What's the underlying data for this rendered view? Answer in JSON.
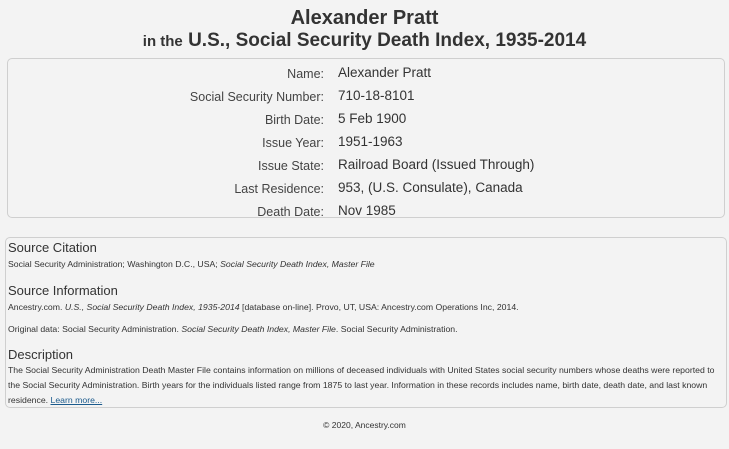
{
  "header": {
    "title": "Alexander Pratt",
    "subtitle_prefix": "in the",
    "subtitle": "U.S., Social Security Death Index, 1935-2014"
  },
  "record": [
    {
      "label": "Name:",
      "value": "Alexander Pratt"
    },
    {
      "label": "Social Security Number:",
      "value": "710-18-8101"
    },
    {
      "label": "Birth Date:",
      "value": "5 Feb 1900"
    },
    {
      "label": "Issue Year:",
      "value": "1951-1963"
    },
    {
      "label": "Issue State:",
      "value": "Railroad Board (Issued Through)"
    },
    {
      "label": "Last Residence:",
      "value": "953, (U.S. Consulate), Canada"
    },
    {
      "label": "Death Date:",
      "value": "Nov 1985"
    }
  ],
  "source_citation": {
    "heading": "Source Citation",
    "text_plain": "Social Security Administration; Washington D.C., USA; ",
    "text_italic": "Social Security Death Index, Master File"
  },
  "source_information": {
    "heading": "Source Information",
    "line1_a": "Ancestry.com. ",
    "line1_italic": "U.S., Social Security Death Index, 1935-2014",
    "line1_b": " [database on-line]. Provo, UT, USA: Ancestry.com Operations Inc, 2014.",
    "line2_a": "Original data: Social Security Administration. ",
    "line2_italic": "Social Security Death Index, Master File",
    "line2_b": ". Social Security Administration."
  },
  "description": {
    "heading": "Description",
    "text": "The Social Security Administration Death Master File contains information on millions of deceased individuals with United States social security numbers whose deaths were reported to the Social Security Administration. Birth years for the individuals listed range from 1875 to last year. Information in these records includes name, birth date, death date, and last known residence. ",
    "link": "Learn more..."
  },
  "footer": "© 2020, Ancestry.com"
}
